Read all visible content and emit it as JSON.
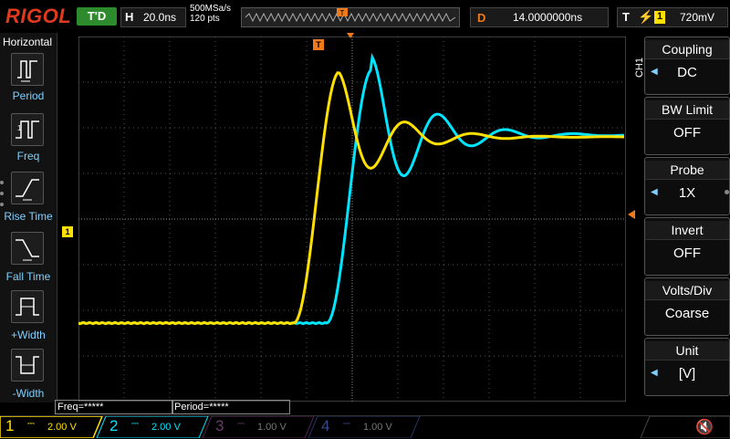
{
  "top": {
    "brand": "RIGOL",
    "trigger_status": "T'D",
    "horizontal_letter": "H",
    "timebase": "20.0ns",
    "sample_rate": "500MSa/s",
    "memory_points": "120 pts",
    "delay_letter": "D",
    "delay_value": "14.0000000ns",
    "trigger_letter": "T",
    "trigger_edge_icon": "rising-edge-icon",
    "trigger_source": "1",
    "trigger_level": "720mV"
  },
  "left_menu": {
    "title": "Horizontal",
    "items": [
      {
        "label": "Period",
        "icon": "period-icon"
      },
      {
        "label": "Freq",
        "icon": "freq-icon"
      },
      {
        "label": "Rise Time",
        "icon": "rise-time-icon"
      },
      {
        "label": "Fall Time",
        "icon": "fall-time-icon"
      },
      {
        "label": "+Width",
        "icon": "pos-width-icon"
      },
      {
        "label": "-Width",
        "icon": "neg-width-icon"
      }
    ]
  },
  "right_menu": {
    "channel_tag": "CH1",
    "items": [
      {
        "title": "Coupling",
        "value": "DC"
      },
      {
        "title": "BW Limit",
        "value": "OFF"
      },
      {
        "title": "Probe",
        "value": "1X"
      },
      {
        "title": "Invert",
        "value": "OFF"
      },
      {
        "title": "Volts/Div",
        "value": "Coarse"
      },
      {
        "title": "Unit",
        "value": "[V]"
      }
    ]
  },
  "measurements": {
    "freq": "Freq=*****",
    "period": "Period=*****"
  },
  "markers": {
    "trigger_marker": "T",
    "ch1_marker": "1"
  },
  "channels": [
    {
      "num": "1",
      "scale": "2.00 V",
      "color": "#ffe000",
      "active": true
    },
    {
      "num": "2",
      "scale": "2.00 V",
      "color": "#00e5ff",
      "active": true
    },
    {
      "num": "3",
      "scale": "1.00 V",
      "color": "#cc33cc",
      "active": false
    },
    {
      "num": "4",
      "scale": "1.00 V",
      "color": "#3355ff",
      "active": false
    }
  ],
  "colors": {
    "ch1": "#ffe000",
    "ch2": "#00e5ff",
    "accent": "#f07a1a",
    "menu_label": "#7fd1ff"
  },
  "sound_icon": "speaker-muted-icon"
}
